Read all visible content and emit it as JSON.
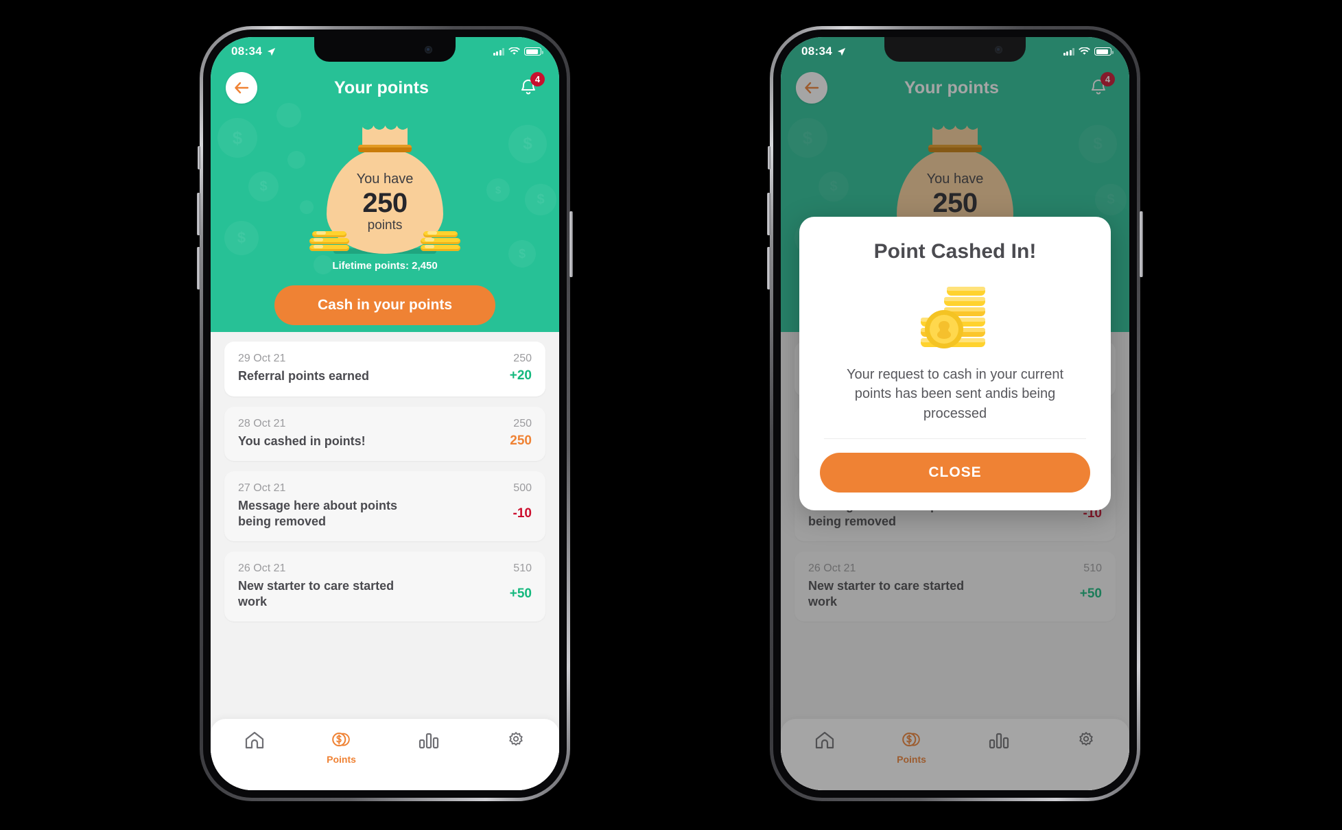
{
  "status_bar": {
    "time": "08:34",
    "location_icon": "location-arrow-icon",
    "signal_icon": "cellular-signal-icon",
    "wifi_icon": "wifi-icon",
    "battery_icon": "battery-icon"
  },
  "app_bar": {
    "back_icon": "back-arrow-icon",
    "title": "Your points",
    "bell_icon": "bell-icon",
    "badge_count": "4"
  },
  "hero": {
    "bag_label": "You have",
    "points_value": "250",
    "points_unit": "points",
    "lifetime": "Lifetime points: 2,450",
    "cta_label": "Cash in your points",
    "green": "#27c196",
    "orange": "#ef8234"
  },
  "transactions": [
    {
      "date": "29 Oct 21",
      "balance": "250",
      "title": "Referral points earned",
      "delta": "+20",
      "delta_kind": "pos"
    },
    {
      "date": "28 Oct 21",
      "balance": "250",
      "title": "You cashed in points!",
      "delta": "250",
      "delta_kind": "org"
    },
    {
      "date": "27 Oct 21",
      "balance": "500",
      "title": "Message here about points being removed",
      "delta": "-10",
      "delta_kind": "neg"
    },
    {
      "date": "26 Oct 21",
      "balance": "510",
      "title": "New starter to care started work",
      "delta": "+50",
      "delta_kind": "pos"
    }
  ],
  "tab_bar": {
    "items": [
      {
        "icon": "home-icon",
        "label": "",
        "active": false
      },
      {
        "icon": "coins-icon",
        "label": "Points",
        "active": true
      },
      {
        "icon": "bar-chart-icon",
        "label": "",
        "active": false
      },
      {
        "icon": "gear-icon",
        "label": "",
        "active": false
      }
    ]
  },
  "modal": {
    "title": "Point Cashed In!",
    "art_icon": "coin-stack-icon",
    "body": "Your request to cash in your current points has been sent andis being processed",
    "close_label": "CLOSE"
  }
}
